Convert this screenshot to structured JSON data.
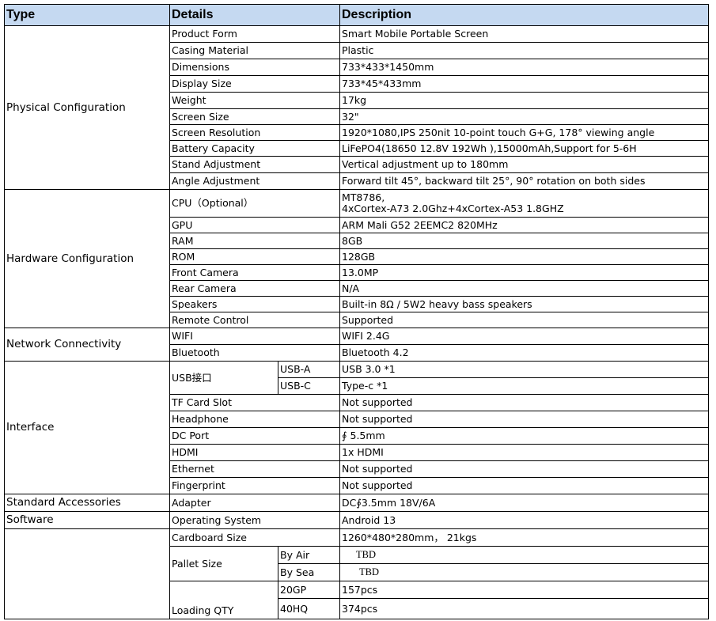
{
  "header": {
    "type": "Type",
    "details": "Details",
    "description": "Description"
  },
  "physical": {
    "category": "Physical Configuration",
    "rows": [
      {
        "label": "Product Form",
        "value": "Smart Mobile Portable Screen"
      },
      {
        "label": "Casing Material",
        "value": "Plastic"
      },
      {
        "label": "Dimensions",
        "value": "733*433*1450mm"
      },
      {
        "label": "Display Size",
        "value": "733*45*433mm"
      },
      {
        "label": "Weight",
        "value": "17kg"
      },
      {
        "label": "Screen Size",
        "value": "32\""
      },
      {
        "label": "Screen Resolution",
        "value": "1920*1080,IPS 250nit 10-point touch G+G, 178° viewing angle"
      },
      {
        "label": "Battery Capacity",
        "value": "LiFePO4(18650 12.8V 192Wh ),15000mAh,Support for 5-6H"
      },
      {
        "label": "Stand Adjustment",
        "value": "Vertical adjustment up to 180mm"
      },
      {
        "label": "Angle Adjustment",
        "value": " Forward tilt 45°, backward tilt 25°, 90° rotation on both sides"
      }
    ]
  },
  "hardware": {
    "category": "Hardware Configuration",
    "cpu_label": "CPU（Optional）",
    "cpu_line1": "MT8786,",
    "cpu_line2": "4xCortex-A73 2.0Ghz+4xCortex-A53 1.8GHZ",
    "rows": [
      {
        "label": "GPU",
        "value": "ARM Mali G52 2EEMC2 820MHz"
      },
      {
        "label": "RAM",
        "value": "8GB"
      },
      {
        "label": "ROM",
        "value": "128GB"
      },
      {
        "label": "Front Camera",
        "value": "13.0MP"
      },
      {
        "label": "Rear Camera",
        "value": "N/A"
      },
      {
        "label": "Speakers",
        "value": "Built-in 8Ω / 5W2 heavy bass speakers"
      },
      {
        "label": "Remote Control",
        "value": "Supported"
      }
    ]
  },
  "network": {
    "category": "Network Connectivity",
    "rows": [
      {
        "label": "WIFI",
        "value": "WIFI 2.4G"
      },
      {
        "label": "Bluetooth",
        "value": "Bluetooth  4.2"
      }
    ]
  },
  "interface": {
    "category": "Interface",
    "usb_label": "USB接口",
    "usb_a": {
      "label": "USB-A",
      "value": "USB 3.0 *1"
    },
    "usb_c": {
      "label": "USB-C",
      "value": "Type-c *1"
    },
    "rows": [
      {
        "label": "TF Card Slot",
        "value": "Not supported"
      },
      {
        "label": "Headphone",
        "value": "Not supported"
      },
      {
        "label": "DC Port",
        "value": "∮ 5.5mm"
      },
      {
        "label": "HDMI",
        "value": "1x HDMI"
      },
      {
        "label": "Ethernet",
        "value": "Not supported"
      },
      {
        "label": "Fingerprint",
        "value": "Not supported"
      }
    ]
  },
  "accessories": {
    "category": "Standard Accessories",
    "label": "Adapter",
    "value": "DC∮3.5mm 18V/6A"
  },
  "software": {
    "category": "Software",
    "label": "Operating System",
    "value": "Android 13"
  },
  "packaging": {
    "cardboard_label": "Cardboard Size",
    "cardboard_value": " 1260*480*280mm，  21kgs",
    "pallet_label": "Pallet Size",
    "by_air_label": "By Air",
    "by_air_value": "TBD",
    "by_sea_label": "By Sea",
    "by_sea_value": "TBD",
    "loading_label": "Loading QTY",
    "gp20_label": "20GP",
    "gp20_value": "157pcs",
    "hq40_label": "40HQ",
    "hq40_value": "374pcs"
  }
}
